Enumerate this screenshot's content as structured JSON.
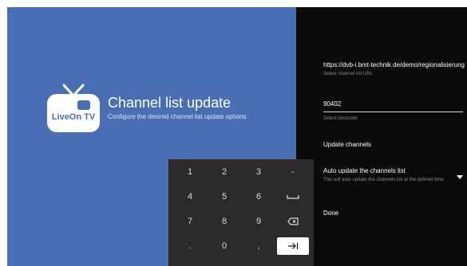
{
  "app": {
    "logo_text": "LiveOn TV",
    "title": "Channel list update",
    "subtitle": "Configure the desired channel list update options"
  },
  "settings": {
    "url_value": "https://dvb-i.bmt-technik.de/demo/regionalisierung",
    "url_hint": "Select channel list URL",
    "postcode_value": "90402",
    "postcode_hint": "Select postcode",
    "update_label": "Update channels",
    "auto_update_label": "Auto update the channels list",
    "auto_update_desc": "This will auto update the channels list at the defined time.",
    "done_label": "Done"
  },
  "keypad": {
    "keys": [
      "1",
      "2",
      "3",
      "-",
      "4",
      "5",
      "6",
      "space-icon",
      "7",
      "8",
      "9",
      "backspace-icon",
      ".",
      "0",
      ",",
      "next-icon"
    ],
    "active_key": "next-icon"
  },
  "colors": {
    "left_panel": "#4a6eb3",
    "right_panel": "#0a0a0a",
    "keypad": "#2a2a2a"
  }
}
